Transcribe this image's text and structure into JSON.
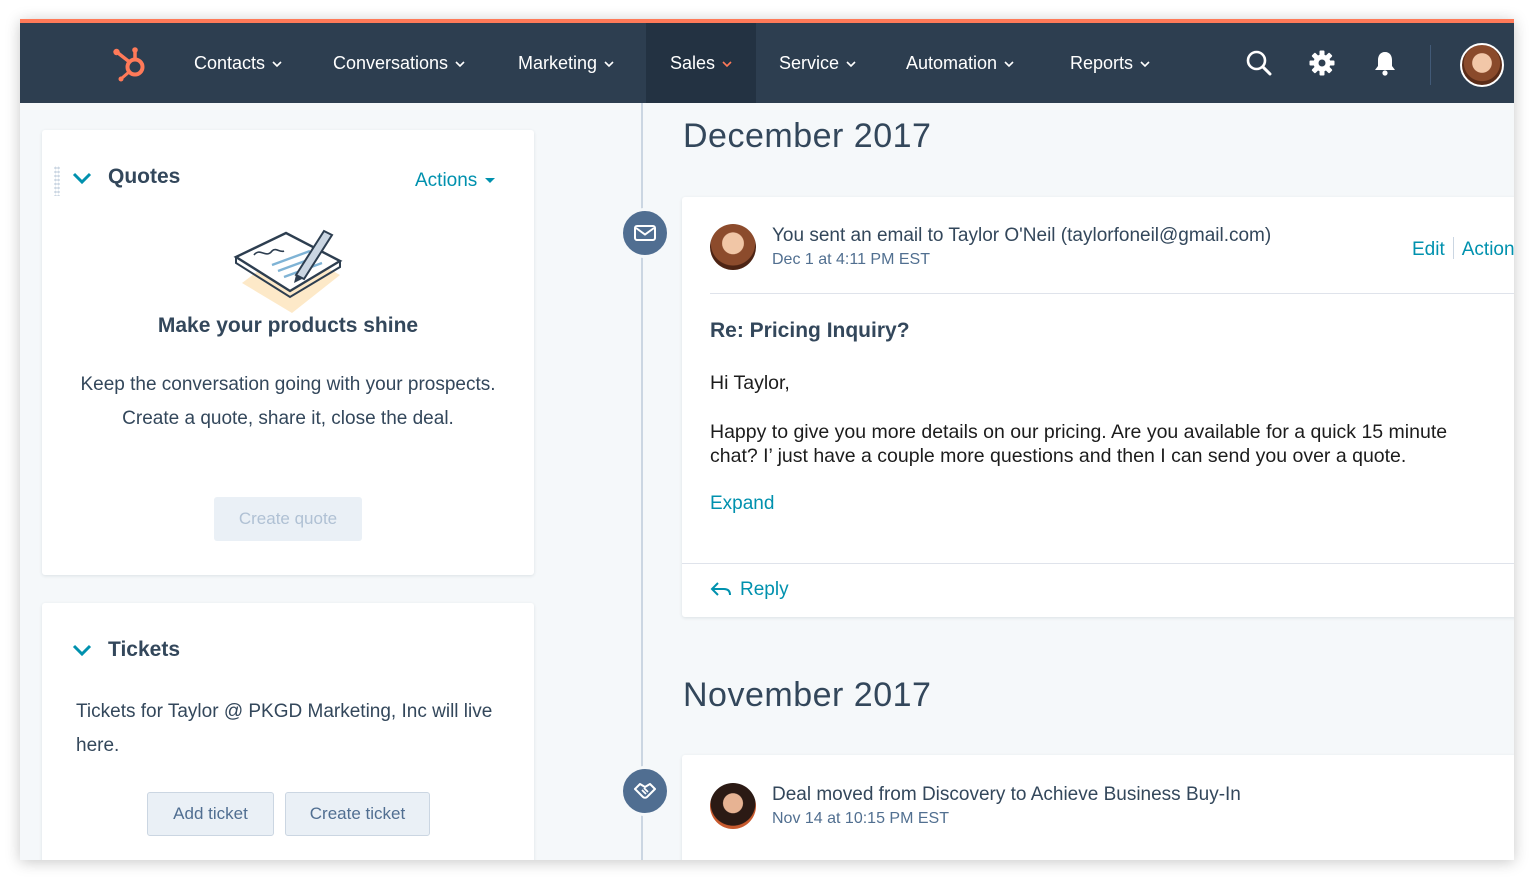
{
  "nav": {
    "logo_icon": "hubspot-sprocket-icon",
    "items": [
      {
        "label": "Contacts"
      },
      {
        "label": "Conversations"
      },
      {
        "label": "Marketing"
      },
      {
        "label": "Sales"
      },
      {
        "label": "Service"
      },
      {
        "label": "Automation"
      },
      {
        "label": "Reports"
      }
    ],
    "active": "Sales",
    "icons": [
      "search-icon",
      "gear-icon",
      "bell-icon"
    ],
    "colors": {
      "bar": "#2d3e50",
      "accent": "#ff7a59",
      "active_bg": "#233242"
    }
  },
  "quotes_card": {
    "title": "Quotes",
    "actions_label": "Actions",
    "empty_title": "Make your products shine",
    "empty_text": "Keep the conversation going with your prospects. Create a quote, share it, close the deal.",
    "create_button": "Create quote"
  },
  "tickets_card": {
    "title": "Tickets",
    "text_before": "Tickets for ",
    "company": "Taylor @ PKGD Marketing, Inc",
    "text_after": " will live here.",
    "add_button": "Add ticket",
    "create_button": "Create ticket"
  },
  "timeline": {
    "months": [
      "December 2017",
      "November 2017"
    ],
    "email_event": {
      "badge_icon": "envelope-icon",
      "actor": "You",
      "action": " sent an email to ",
      "recipient": "Taylor O'Neil",
      "recipient_email": " (taylorfoneil@gmail.com)",
      "time": "Dec 1 at 4:11 PM EST",
      "edit_label": "Edit",
      "actions_label": "Actions",
      "subject": "Re: Pricing Inquiry?",
      "greeting": "Hi Taylor,",
      "body": "Happy to give you more details on our pricing. Are you available for a quick 15 minute chat? I’ just have a couple more questions and then I can send you over a quote.",
      "expand_label": "Expand",
      "reply_label": "Reply"
    },
    "deal_event": {
      "badge_icon": "handshake-icon",
      "prefix": "Deal moved from ",
      "from_stage": "Discovery",
      "middle": " to ",
      "to_stage": "Achieve Business Buy-In",
      "time": "Nov 14 at 10:15 PM EST"
    }
  },
  "colors": {
    "link": "#0091ae",
    "text": "#33475b",
    "muted": "#516f90",
    "page_bg": "#f5f8fa"
  }
}
